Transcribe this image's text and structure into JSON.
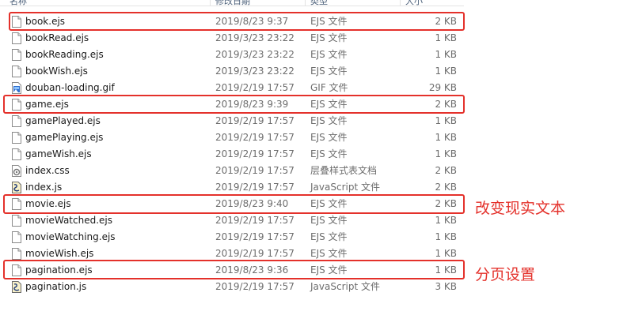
{
  "header": {
    "columns": [
      "名称",
      "修改日期",
      "类型",
      "大小"
    ]
  },
  "files": [
    {
      "name": "book.ejs",
      "date": "2019/8/23 9:37",
      "type": "EJS 文件",
      "size": "2 KB",
      "icon": "blank-file-icon"
    },
    {
      "name": "bookRead.ejs",
      "date": "2019/3/23 23:22",
      "type": "EJS 文件",
      "size": "1 KB",
      "icon": "blank-file-icon"
    },
    {
      "name": "bookReading.ejs",
      "date": "2019/3/23 23:22",
      "type": "EJS 文件",
      "size": "1 KB",
      "icon": "blank-file-icon"
    },
    {
      "name": "bookWish.ejs",
      "date": "2019/3/23 23:22",
      "type": "EJS 文件",
      "size": "1 KB",
      "icon": "blank-file-icon"
    },
    {
      "name": "douban-loading.gif",
      "date": "2019/2/19 17:57",
      "type": "GIF 文件",
      "size": "29 KB",
      "icon": "image-file-icon"
    },
    {
      "name": "game.ejs",
      "date": "2019/8/23 9:39",
      "type": "EJS 文件",
      "size": "2 KB",
      "icon": "blank-file-icon"
    },
    {
      "name": "gamePlayed.ejs",
      "date": "2019/2/19 17:57",
      "type": "EJS 文件",
      "size": "1 KB",
      "icon": "blank-file-icon"
    },
    {
      "name": "gamePlaying.ejs",
      "date": "2019/2/19 17:57",
      "type": "EJS 文件",
      "size": "1 KB",
      "icon": "blank-file-icon"
    },
    {
      "name": "gameWish.ejs",
      "date": "2019/2/19 17:57",
      "type": "EJS 文件",
      "size": "1 KB",
      "icon": "blank-file-icon"
    },
    {
      "name": "index.css",
      "date": "2019/2/19 17:57",
      "type": "层叠样式表文档",
      "size": "2 KB",
      "icon": "css-file-icon"
    },
    {
      "name": "index.js",
      "date": "2019/2/19 17:57",
      "type": "JavaScript 文件",
      "size": "2 KB",
      "icon": "js-file-icon"
    },
    {
      "name": "movie.ejs",
      "date": "2019/8/23 9:40",
      "type": "EJS 文件",
      "size": "2 KB",
      "icon": "blank-file-icon"
    },
    {
      "name": "movieWatched.ejs",
      "date": "2019/2/19 17:57",
      "type": "EJS 文件",
      "size": "1 KB",
      "icon": "blank-file-icon"
    },
    {
      "name": "movieWatching.ejs",
      "date": "2019/2/19 17:57",
      "type": "EJS 文件",
      "size": "1 KB",
      "icon": "blank-file-icon"
    },
    {
      "name": "movieWish.ejs",
      "date": "2019/2/19 17:57",
      "type": "EJS 文件",
      "size": "1 KB",
      "icon": "blank-file-icon"
    },
    {
      "name": "pagination.ejs",
      "date": "2019/8/23 9:36",
      "type": "EJS 文件",
      "size": "1 KB",
      "icon": "blank-file-icon"
    },
    {
      "name": "pagination.js",
      "date": "2019/2/19 17:57",
      "type": "JavaScript 文件",
      "size": "3 KB",
      "icon": "js-file-icon"
    }
  ],
  "annotations": {
    "movie_note": "改变现实文本",
    "pagination_note": "分页设置",
    "highlight_color": "#e4312b"
  }
}
